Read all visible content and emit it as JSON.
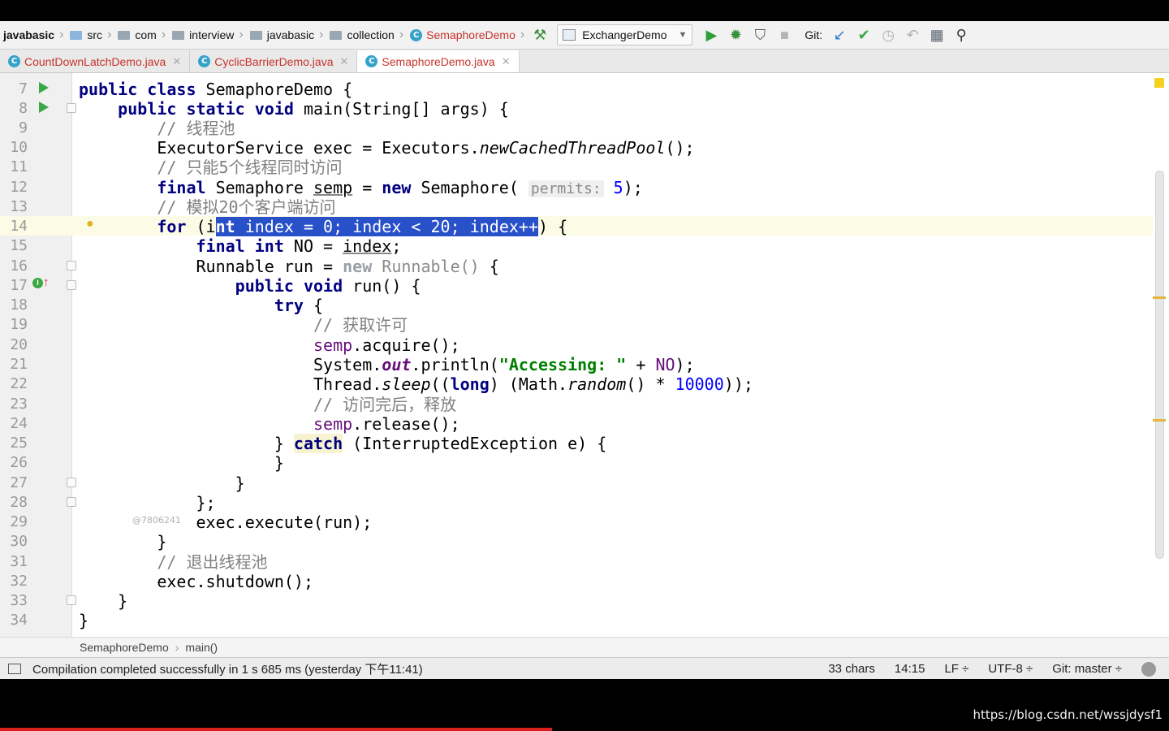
{
  "navbar": {
    "crumbs": [
      "javabasic",
      "src",
      "com",
      "interview",
      "javabasic",
      "collection",
      "SemaphoreDemo"
    ],
    "run_config": "ExchangerDemo",
    "git_label": "Git:"
  },
  "tabs": [
    {
      "label": "CountDownLatchDemo.java"
    },
    {
      "label": "CyclicBarrierDemo.java"
    },
    {
      "label": "SemaphoreDemo.java"
    }
  ],
  "editor": {
    "line_numbers": [
      "7",
      "8",
      "9",
      "10",
      "11",
      "12",
      "13",
      "14",
      "15",
      "16",
      "17",
      "18",
      "19",
      "20",
      "21",
      "22",
      "23",
      "24",
      "25",
      "26",
      "27",
      "28",
      "29",
      "30",
      "31",
      "32",
      "33",
      "34"
    ],
    "author_mark": "@7806241",
    "code": {
      "l7_kw": "public class",
      "l7_name": " SemaphoreDemo {",
      "l8_indent": "    ",
      "l8_kw": "public static void",
      "l8_rest": " main(String[] args) {",
      "l9": "        // 线程池",
      "l10_a": "        ExecutorService exec = Executors.",
      "l10_m": "newCachedThreadPool",
      "l10_b": "();",
      "l11": "        // 只能5个线程同时访问",
      "l12_ind": "        ",
      "l12_kw": "final",
      "l12_a": " Semaphore ",
      "l12_var": "semp",
      "l12_b": " = ",
      "l12_new": "new",
      "l12_c": " Semaphore( ",
      "l12_hint": "permits:",
      "l12_num": " 5",
      "l12_d": ");",
      "l13": "        // 模拟20个客户端访问",
      "l14_ind": "        ",
      "l14_kw": "for",
      "l14_a": " (i",
      "l14_sel_kw": "nt",
      "l14_sel_a": " index = ",
      "l14_sel_n1": "0",
      "l14_sel_b": "; index < ",
      "l14_sel_n2": "20",
      "l14_sel_c": "; index++",
      "l14_b": ") {",
      "l15_ind": "            ",
      "l15_kw": "final int",
      "l15_a": " NO = ",
      "l15_var": "index",
      "l15_b": ";",
      "l16_a": "            Runnable run = ",
      "l16_new": "new",
      "l16_b": " Runnable()",
      "l16_c": " {",
      "l17_ind": "                ",
      "l17_kw": "public void",
      "l17_a": " run() {",
      "l18_ind": "                    ",
      "l18_kw": "try",
      "l18_a": " {",
      "l19": "                        // 获取许可",
      "l20_ind": "                        ",
      "l20_var": "semp",
      "l20_a": ".acquire();",
      "l21_a": "                        System.",
      "l21_out": "out",
      "l21_b": ".println(",
      "l21_str": "\"Accessing: \"",
      "l21_c": " + ",
      "l21_no": "NO",
      "l21_d": ");",
      "l22_a": "                        Thread.",
      "l22_m": "sleep",
      "l22_b": "((",
      "l22_kw": "long",
      "l22_c": ") (Math.",
      "l22_r": "random",
      "l22_d": "() * ",
      "l22_num": "10000",
      "l22_e": "));",
      "l23": "                        // 访问完后，释放",
      "l24_ind": "                        ",
      "l24_var": "semp",
      "l24_a": ".release();",
      "l25_a": "                    } ",
      "l25_kw": "catch",
      "l25_b": " (InterruptedException e) {",
      "l26": "                    }",
      "l27": "                }",
      "l28": "            };",
      "l29": "            exec.execute(run);",
      "l30": "        }",
      "l31": "        // 退出线程池",
      "l32": "        exec.shutdown();",
      "l33": "    }",
      "l34": "}"
    }
  },
  "breadcrumb_footer": [
    "SemaphoreDemo",
    "main()"
  ],
  "status": {
    "message": "Compilation completed successfully in 1 s 685 ms (yesterday 下午11:41)",
    "chars": "33 chars",
    "position": "14:15",
    "line_sep": "LF ÷",
    "encoding": "UTF-8 ÷",
    "git_branch": "Git: master ÷"
  },
  "watermark": "https://blog.csdn.net/wssjdysf1",
  "colors": {
    "keyword": "#000080",
    "comment": "#808080",
    "string": "#008000",
    "number": "#0000ff",
    "selection": "#2850c8",
    "accent_red": "#c7342c"
  },
  "icons": [
    "folder-icon",
    "class-icon",
    "build-hammer-icon",
    "run-icon",
    "debug-icon",
    "coverage-icon",
    "stop-icon",
    "git-update-icon",
    "git-commit-icon",
    "history-icon",
    "revert-icon",
    "project-structure-icon",
    "search-icon",
    "bulb-icon",
    "override-icon"
  ]
}
